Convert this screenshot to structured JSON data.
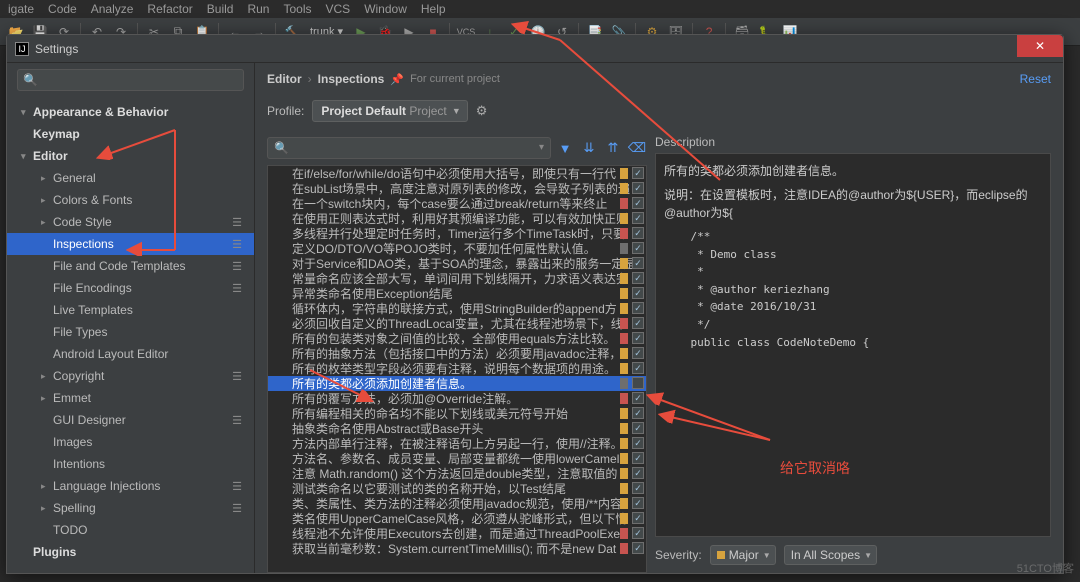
{
  "menubar": [
    "igate",
    "Code",
    "Analyze",
    "Refactor",
    "Build",
    "Run",
    "Tools",
    "VCS",
    "Window",
    "Help"
  ],
  "trunk": "trunk ▾",
  "window": {
    "title": "Settings"
  },
  "breadcrumb": {
    "a": "Editor",
    "b": "Inspections",
    "sub": "For current project",
    "reset": "Reset"
  },
  "profile": {
    "label": "Profile:",
    "value": "Project Default",
    "scope": "Project"
  },
  "sidebar": {
    "items": [
      {
        "label": "Appearance & Behavior",
        "level": 1,
        "exp": "▾"
      },
      {
        "label": "Keymap",
        "level": 1,
        "exp": ""
      },
      {
        "label": "Editor",
        "level": 1,
        "exp": "▾"
      },
      {
        "label": "General",
        "level": 2,
        "exp": "▸"
      },
      {
        "label": "Colors & Fonts",
        "level": 2,
        "exp": "▸"
      },
      {
        "label": "Code Style",
        "level": 2,
        "exp": "▸",
        "gear": true
      },
      {
        "label": "Inspections",
        "level": 2,
        "exp": "",
        "sel": true,
        "gear": true
      },
      {
        "label": "File and Code Templates",
        "level": 2,
        "exp": "",
        "gear": true
      },
      {
        "label": "File Encodings",
        "level": 2,
        "exp": "",
        "gear": true
      },
      {
        "label": "Live Templates",
        "level": 2,
        "exp": ""
      },
      {
        "label": "File Types",
        "level": 2,
        "exp": ""
      },
      {
        "label": "Android Layout Editor",
        "level": 2,
        "exp": ""
      },
      {
        "label": "Copyright",
        "level": 2,
        "exp": "▸",
        "gear": true
      },
      {
        "label": "Emmet",
        "level": 2,
        "exp": "▸"
      },
      {
        "label": "GUI Designer",
        "level": 2,
        "exp": "",
        "gear": true
      },
      {
        "label": "Images",
        "level": 2,
        "exp": ""
      },
      {
        "label": "Intentions",
        "level": 2,
        "exp": ""
      },
      {
        "label": "Language Injections",
        "level": 2,
        "exp": "▸",
        "gear": true
      },
      {
        "label": "Spelling",
        "level": 2,
        "exp": "▸",
        "gear": true
      },
      {
        "label": "TODO",
        "level": 2,
        "exp": ""
      },
      {
        "label": "Plugins",
        "level": 1,
        "exp": ""
      }
    ]
  },
  "inspections": [
    {
      "t": "在if/else/for/while/do语句中必须使用大括号，即使只有一行代",
      "sev": "yellow",
      "chk": true
    },
    {
      "t": "在subList场景中，高度注意对原列表的修改，会导致子列表的遍",
      "sev": "yellow",
      "chk": true
    },
    {
      "t": "在一个switch块内，每个case要么通过break/return等来终止",
      "sev": "red",
      "chk": true
    },
    {
      "t": "在使用正则表达式时，利用好其预编译功能，可以有效加快正则",
      "sev": "yellow",
      "chk": true
    },
    {
      "t": "多线程并行处理定时任务时，Timer运行多个TimeTask时，只要",
      "sev": "red",
      "chk": true
    },
    {
      "t": "定义DO/DTO/VO等POJO类时，不要加任何属性默认值。",
      "sev": "gray",
      "chk": true
    },
    {
      "t": "对于Service和DAO类，基于SOA的理念，暴露出来的服务一定是",
      "sev": "yellow",
      "chk": true
    },
    {
      "t": "常量命名应该全部大写，单词间用下划线隔开，力求语义表达完",
      "sev": "yellow",
      "chk": true
    },
    {
      "t": "异常类命名使用Exception结尾",
      "sev": "yellow",
      "chk": true
    },
    {
      "t": "循环体内，字符串的联接方式，使用StringBuilder的append方",
      "sev": "yellow",
      "chk": true
    },
    {
      "t": "必须回收自定义的ThreadLocal变量，尤其在线程池场景下，线",
      "sev": "red",
      "chk": true
    },
    {
      "t": "所有的包装类对象之间值的比较，全部使用equals方法比较。",
      "sev": "red",
      "chk": true
    },
    {
      "t": "所有的抽象方法（包括接口中的方法）必须要用javadoc注释，",
      "sev": "yellow",
      "chk": true
    },
    {
      "t": "所有的枚举类型字段必须要有注释，说明每个数据项的用途。",
      "sev": "yellow",
      "chk": true
    },
    {
      "t": "所有的类都必须添加创建者信息。",
      "sev": "gray",
      "sel": true,
      "chk": false
    },
    {
      "t": "所有的覆写方法，必须加@Override注解。",
      "sev": "red",
      "chk": true
    },
    {
      "t": "所有编程相关的命名均不能以下划线或美元符号开始",
      "sev": "yellow",
      "chk": true
    },
    {
      "t": "抽象类命名使用Abstract或Base开头",
      "sev": "yellow",
      "chk": true
    },
    {
      "t": "方法内部单行注释，在被注释语句上方另起一行，使用//注释。",
      "sev": "yellow",
      "chk": true
    },
    {
      "t": "方法名、参数名、成员变量、局部变量都统一使用lowerCamelC",
      "sev": "yellow",
      "chk": true
    },
    {
      "t": "注意 Math.random() 这个方法返回是double类型，注意取值的",
      "sev": "yellow",
      "chk": true
    },
    {
      "t": "测试类命名以它要测试的类的名称开始，以Test结尾",
      "sev": "yellow",
      "chk": true
    },
    {
      "t": "类、类属性、类方法的注释必须使用javadoc规范，使用/**内容",
      "sev": "yellow",
      "chk": true
    },
    {
      "t": "类名使用UpperCamelCase风格，必须遵从驼峰形式，但以下情",
      "sev": "yellow",
      "chk": true
    },
    {
      "t": "线程池不允许使用Executors去创建，而是通过ThreadPoolExe",
      "sev": "red",
      "chk": true
    },
    {
      "t": "获取当前毫秒数：System.currentTimeMillis(); 而不是new Dat",
      "sev": "red",
      "chk": true
    }
  ],
  "desc": {
    "title": "Description",
    "intro1": "所有的类都必须添加创建者信息。",
    "intro2": "说明：在设置模板时，注意IDEA的@author为${USER}，而eclipse的@author为${",
    "code": "    /**\n     * Demo class\n     *\n     * @author keriezhang\n     * @date 2016/10/31\n     */\n    public class CodeNoteDemo {\n    "
  },
  "severity": {
    "label": "Severity:",
    "value": "Major",
    "scope": "In All Scopes"
  },
  "annotation": "给它取消咯",
  "watermark": "51CTO博客"
}
